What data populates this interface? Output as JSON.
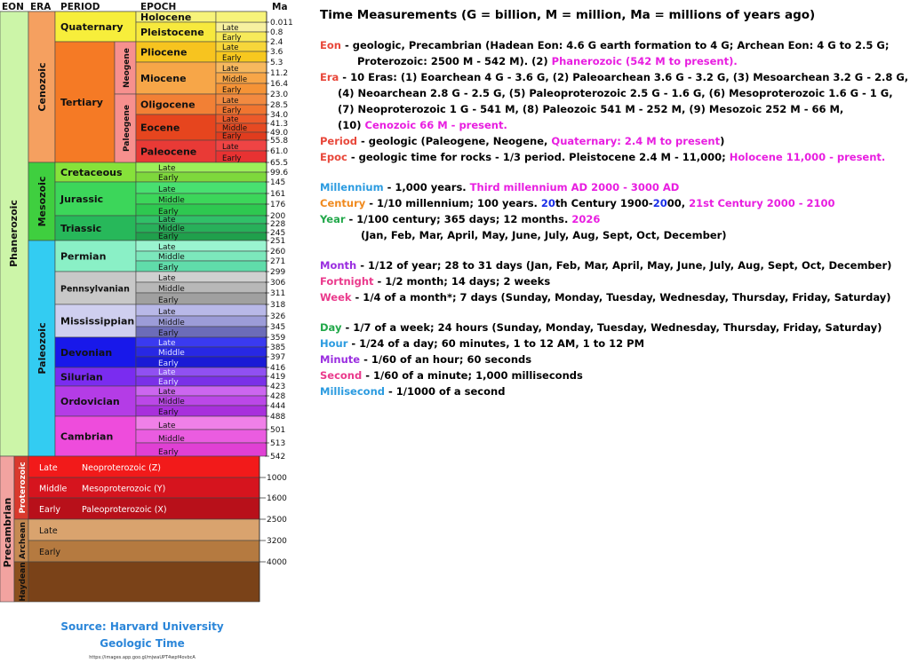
{
  "headers": {
    "eon": "EON",
    "era": "ERA",
    "period": "PERIOD",
    "epoch": "EPOCH",
    "ma": "Ma"
  },
  "eons": [
    {
      "label": "Phanerozoic",
      "color": "#ccf5a8"
    },
    {
      "label": "Precambrian",
      "color": "#f2a3a0"
    }
  ],
  "precambrian_eons": [
    {
      "label": "Proterozoic",
      "color": "#d9392d"
    },
    {
      "label": "Archean",
      "color": "#c58a52"
    },
    {
      "label": "Haydean",
      "color": "#8a4f1d"
    }
  ],
  "eras": [
    {
      "label": "Cenozoic",
      "color": "#f5a060"
    },
    {
      "label": "Mesozoic",
      "color": "#3fcf3f"
    },
    {
      "label": "Paleozoic",
      "color": "#33ccf2"
    }
  ],
  "periods": [
    {
      "label": "Quaternary",
      "color": "#f7ee3b"
    },
    {
      "label": "Tertiary",
      "color": "#f57a25"
    },
    {
      "label": "Cretaceous",
      "color": "#86e23a"
    },
    {
      "label": "Jurassic",
      "color": "#3cd65a"
    },
    {
      "label": "Triassic",
      "color": "#27b85a"
    },
    {
      "label": "Permian",
      "color": "#8af0c6"
    },
    {
      "label": "Pennsylvanian",
      "color": "#c8c8c8"
    },
    {
      "label": "Mississippian",
      "color": "#cfcfef"
    },
    {
      "label": "Devonian",
      "color": "#1818ea"
    },
    {
      "label": "Silurian",
      "color": "#7a2cf0"
    },
    {
      "label": "Ordovician",
      "color": "#b43ce6"
    },
    {
      "label": "Cambrian",
      "color": "#ee4cdc"
    }
  ],
  "subperiods": [
    {
      "label": "Neogene",
      "color": "#f7908e"
    },
    {
      "label": "Paleogene",
      "color": "#f7908e"
    }
  ],
  "epochs": [
    {
      "label": "Holocene",
      "color": "#f7f37a"
    },
    {
      "label": "Pleistocene",
      "color": "#f7e93d"
    },
    {
      "label": "Pliocene",
      "color": "#f7c41f"
    },
    {
      "label": "Miocene",
      "color": "#f7a648"
    },
    {
      "label": "Oligocene",
      "color": "#f28035"
    },
    {
      "label": "Eocene",
      "color": "#e6451e"
    },
    {
      "label": "Paleocene",
      "color": "#e93a36"
    }
  ],
  "subepochs": [
    {
      "label": "Late",
      "color": "#f7f0a0"
    },
    {
      "label": "Early",
      "color": "#f7ea5a"
    },
    {
      "label": "Late",
      "color": "#f7d63a"
    },
    {
      "label": "Early",
      "color": "#f7c81f"
    },
    {
      "label": "Late",
      "color": "#f7b85e"
    },
    {
      "label": "Middle",
      "color": "#f7a648"
    },
    {
      "label": "Early",
      "color": "#f59336"
    },
    {
      "label": "Late",
      "color": "#f28a40"
    },
    {
      "label": "Early",
      "color": "#f07530"
    },
    {
      "label": "Late",
      "color": "#ec5a2a"
    },
    {
      "label": "Middle",
      "color": "#e64a22"
    },
    {
      "label": "Early",
      "color": "#e03c1e"
    },
    {
      "label": "Late",
      "color": "#ef4444"
    },
    {
      "label": "Early",
      "color": "#e83232"
    },
    {
      "label": "Late",
      "color": "#9cf05a"
    },
    {
      "label": "Early",
      "color": "#7ed83c"
    },
    {
      "label": "Late",
      "color": "#48e070"
    },
    {
      "label": "Middle",
      "color": "#3cd65a"
    },
    {
      "label": "Early",
      "color": "#2ec850"
    },
    {
      "label": "Late",
      "color": "#30c068"
    },
    {
      "label": "Middle",
      "color": "#28b05a"
    },
    {
      "label": "Early",
      "color": "#20a04c"
    },
    {
      "label": "Late",
      "color": "#9af4d0"
    },
    {
      "label": "Middle",
      "color": "#7ce8bc"
    },
    {
      "label": "Early",
      "color": "#60dcaa"
    },
    {
      "label": "Late",
      "color": "#d0d0d0"
    },
    {
      "label": "Middle",
      "color": "#b8b8b8"
    },
    {
      "label": "Early",
      "color": "#a0a0a0"
    },
    {
      "label": "Late",
      "color": "#b8b8e8"
    },
    {
      "label": "Middle",
      "color": "#9c9cd8"
    },
    {
      "label": "Early",
      "color": "#6c6cb8"
    },
    {
      "label": "Late",
      "color": "#3a3af0"
    },
    {
      "label": "Middle",
      "color": "#2828e4"
    },
    {
      "label": "Early",
      "color": "#1a1ad6"
    },
    {
      "label": "Late",
      "color": "#9050f2"
    },
    {
      "label": "Early",
      "color": "#7a30e8"
    },
    {
      "label": "Late",
      "color": "#cc66f0"
    },
    {
      "label": "Middle",
      "color": "#bb48e8"
    },
    {
      "label": "Early",
      "color": "#a830dc"
    },
    {
      "label": "Late",
      "color": "#f080e8"
    },
    {
      "label": "Middle",
      "color": "#ea5ce0"
    },
    {
      "label": "Early",
      "color": "#e040d4"
    }
  ],
  "precambrian_bands": [
    {
      "sub": "Late",
      "label": "Neoproterozoic (Z)",
      "color": "#f21a1a"
    },
    {
      "sub": "Middle",
      "label": "Mesoproterozoic (Y)",
      "color": "#d6141e"
    },
    {
      "sub": "Early",
      "label": "Paleoproterozoic (X)",
      "color": "#b8101a"
    },
    {
      "sub": "Late",
      "label": "",
      "color": "#d9a36e"
    },
    {
      "sub": "Early",
      "label": "",
      "color": "#b57a40"
    },
    {
      "sub": "",
      "label": "",
      "color": "#7a4218"
    }
  ],
  "ma_ticks": [
    "0.011",
    "0.8",
    "2.4",
    "3.6",
    "5.3",
    "11.2",
    "16.4",
    "23.0",
    "28.5",
    "34.0",
    "41.3",
    "49.0",
    "55.8",
    "61.0",
    "65.5",
    "99.6",
    "145",
    "161",
    "176",
    "200",
    "228",
    "245",
    "251",
    "260",
    "271",
    "299",
    "306",
    "311",
    "318",
    "326",
    "345",
    "359",
    "385",
    "397",
    "416",
    "419",
    "423",
    "428",
    "444",
    "488",
    "501",
    "513",
    "542",
    "1000",
    "1600",
    "2500",
    "3200",
    "4000"
  ],
  "source": {
    "line1": "Source: Harvard University",
    "line2": "Geologic Time",
    "url": "https://images.app.goo.gl/mjwaUPT4wpf4ovbcA"
  },
  "definitions": {
    "title": "Time Measurements (G = billion, M = million, Ma = millions of years ago)",
    "eon": {
      "term": "Eon",
      "color": "#e8473a",
      "l1": " - geologic, Precambrian (Hadean Eon: 4.6 G earth formation to 4 G;  Archean Eon: 4 G to 2.5 G;",
      "l2a": "Proterozoic: 2500 M - 542 M). (2) ",
      "l2b": "Phanerozoic (542 M to present)."
    },
    "era": {
      "term": "Era",
      "color": "#e8473a",
      "l1": " - 10 Eras: (1) Eoarchean 4 G - 3.6 G, (2) Paleoarchean 3.6 G - 3.2 G, (3) Mesoarchean 3.2 G - 2.8 G,",
      "l2": "(4) Neoarchean 2.8 G - 2.5 G, (5) Paleoproterozoic 2.5 G - 1.6 G, (6) Mesoproterozoic 1.6 G - 1 G,",
      "l3": "(7) Neoproterozoic 1 G - 541 M, (8) Paleozoic 541 M - 252 M, (9) Mesozoic 252 M - 66 M,",
      "l4a": "(10) ",
      "l4b": "Cenozoic 66 M - present."
    },
    "period": {
      "term": "Period",
      "color": "#e8473a",
      "l1": " - geologic (Paleogene, Neogene, ",
      "l1b": "Quaternary: 2.4 M to present",
      "l1c": ")"
    },
    "epoc": {
      "term": "Epoc",
      "color": "#e8473a",
      "l1": " - geologic time for rocks - 1/3 period. Pleistocene 2.4 M - 11,000; ",
      "l1b": "Holocene 11,000 - present."
    },
    "millennium": {
      "term": "Millennium",
      "color": "#2b9be0",
      "l1": " - 1,000 years.  ",
      "l1b": "Third millennium AD 2000 - 3000 AD"
    },
    "century": {
      "term": "Century",
      "color": "#f08a1e",
      "l1": " - 1/10 millennium; 100 years. ",
      "l1num": "20",
      "l1mid": "th Century 1900-",
      "l1d": "20",
      "l1end": "00, ",
      "l1b": "21st Century 2000 - 2100"
    },
    "year": {
      "term": "Year",
      "color": "#22a84a",
      "l1": " - 1/100 century; 365 days; 12 months.  ",
      "l1b": "2026",
      "l2": "(Jan, Feb, Mar, April, May, June, July, Aug, Sept, Oct, December)"
    },
    "month": {
      "term": "Month",
      "color": "#9a2ee0",
      "l1": " - 1/12 of year; 28 to 31 days  (Jan, Feb, Mar, April, May, June, July, Aug, Sept, Oct, December)"
    },
    "fortnight": {
      "term": "Fortnight",
      "color": "#ea3a8c",
      "l1": " - 1/2 month; 14 days; 2 weeks"
    },
    "week": {
      "term": "Week",
      "color": "#ea3a8c",
      "l1": " - 1/4 of a month*; 7 days  (Sunday, Monday, Tuesday, Wednesday, Thursday, Friday, Saturday)"
    },
    "day": {
      "term": "Day",
      "color": "#22a84a",
      "l1": " - 1/7 of a week; 24 hours (Sunday, Monday, Tuesday, Wednesday, Thursday, Friday, Saturday)"
    },
    "hour": {
      "term": "Hour",
      "color": "#2b9be0",
      "l1": " - 1/24 of a day; 60 minutes, 1 to 12 AM, 1 to 12 PM"
    },
    "minute": {
      "term": "Minute",
      "color": "#9a2ee0",
      "l1": " - 1/60 of an hour; 60 seconds"
    },
    "second": {
      "term": "Second",
      "color": "#ea3a8c",
      "l1": " - 1/60 of a minute; 1,000 milliseconds"
    },
    "millisecond": {
      "term": "Millisecond",
      "color": "#2b9be0",
      "l1": " - 1/1000 of a second"
    },
    "colors": {
      "magenta": "#e81ee0",
      "blue": "#1a2ee8"
    }
  }
}
